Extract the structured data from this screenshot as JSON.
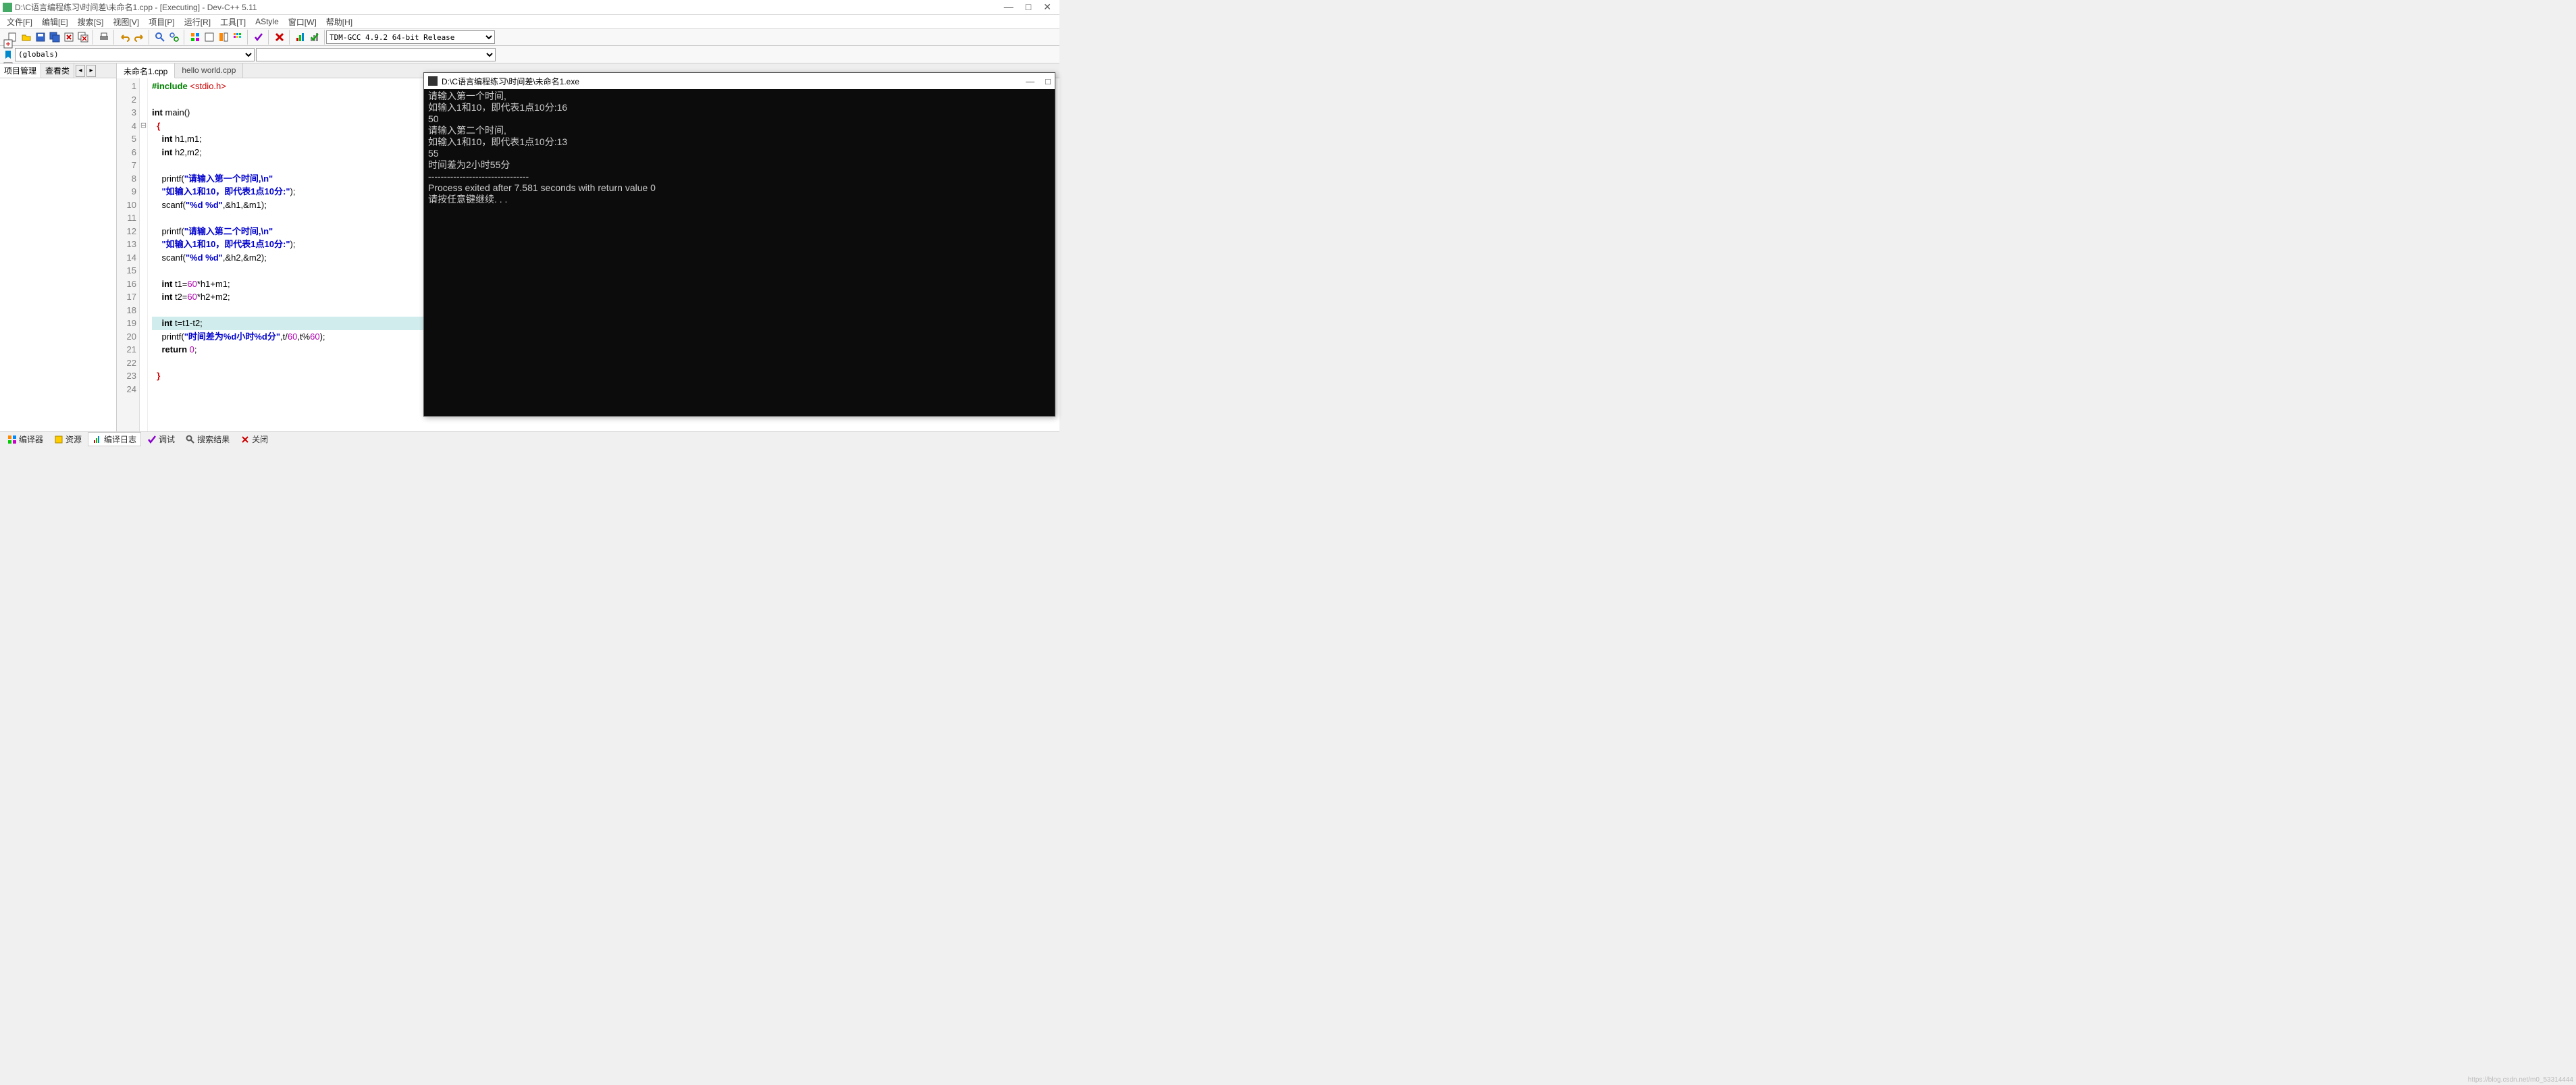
{
  "window": {
    "title": "D:\\C语言编程练习\\时间差\\未命名1.cpp - [Executing] - Dev-C++ 5.11",
    "min": "—",
    "max": "□",
    "close": "✕"
  },
  "menubar": [
    "文件[F]",
    "编辑[E]",
    "搜索[S]",
    "视图[V]",
    "项目[P]",
    "运行[R]",
    "工具[T]",
    "AStyle",
    "窗口[W]",
    "帮助[H]"
  ],
  "toolbar": {
    "compiler_profile": "TDM-GCC 4.9.2 64-bit Release"
  },
  "toolbar2": {
    "scope": "(globals)",
    "members": ""
  },
  "sidebar": {
    "tabs": [
      "项目管理",
      "查看类"
    ]
  },
  "editor_tabs": [
    {
      "label": "未命名1.cpp",
      "active": true
    },
    {
      "label": "hello world.cpp",
      "active": false
    }
  ],
  "code_lines": [
    {
      "n": 1,
      "html": "<span class='pp'>#include</span> <span class='hd'>&lt;stdio.h&gt;</span>"
    },
    {
      "n": 2,
      "html": ""
    },
    {
      "n": 3,
      "html": "<span class='kw'>int</span> <span class='fn'>main</span><span class='pn'>()</span>"
    },
    {
      "n": 4,
      "fold": "⊟",
      "html": "  <span class='br'>{</span>"
    },
    {
      "n": 5,
      "html": "    <span class='kw'>int</span> h1,m1;"
    },
    {
      "n": 6,
      "html": "    <span class='kw'>int</span> h2,m2;"
    },
    {
      "n": 7,
      "html": "    "
    },
    {
      "n": 8,
      "html": "    printf(<span class='str'>\"请输入第一个时间,\\n\"</span>"
    },
    {
      "n": 9,
      "html": "    <span class='str'>\"如输入1和10，即代表1点10分:\"</span>);"
    },
    {
      "n": 10,
      "html": "    scanf(<span class='str'>\"%d %d\"</span>,&amp;h1,&amp;m1);"
    },
    {
      "n": 11,
      "html": "    "
    },
    {
      "n": 12,
      "html": "    printf(<span class='str'>\"请输入第二个时间,\\n\"</span>"
    },
    {
      "n": 13,
      "html": "    <span class='str'>\"如输入1和10，即代表1点10分:\"</span>);"
    },
    {
      "n": 14,
      "html": "    scanf(<span class='str'>\"%d %d\"</span>,&amp;h2,&amp;m2);"
    },
    {
      "n": 15,
      "html": "    "
    },
    {
      "n": 16,
      "html": "    <span class='kw'>int</span> t1=<span class='num'>60</span>*h1+m1;"
    },
    {
      "n": 17,
      "html": "    <span class='kw'>int</span> t2=<span class='num'>60</span>*h2+m2;"
    },
    {
      "n": 18,
      "html": "    "
    },
    {
      "n": 19,
      "hl": true,
      "html": "    <span class='kw'>int</span> t=t1-t2;"
    },
    {
      "n": 20,
      "html": "    printf(<span class='str'>\"时间差为%d小时%d分\"</span>,t/<span class='num'>60</span>,t%<span class='num'>60</span>);"
    },
    {
      "n": 21,
      "html": "    <span class='kw'>return</span> <span class='num'>0</span>;"
    },
    {
      "n": 22,
      "html": "    "
    },
    {
      "n": 23,
      "html": "  <span class='br'>}</span>"
    },
    {
      "n": 24,
      "html": ""
    }
  ],
  "console": {
    "title": "D:\\C语言编程练习\\时间差\\未命名1.exe",
    "lines": [
      "请输入第一个时间,",
      "如输入1和10，即代表1点10分:16",
      "50",
      "请输入第二个时间,",
      "如输入1和10，即代表1点10分:13",
      "55",
      "时间差为2小时55分",
      "--------------------------------",
      "Process exited after 7.581 seconds with return value 0",
      "请按任意键继续. . ."
    ]
  },
  "bottom_tabs": [
    {
      "label": "编译器",
      "icon": "grid"
    },
    {
      "label": "资源",
      "icon": "res"
    },
    {
      "label": "编译日志",
      "icon": "log",
      "active": true
    },
    {
      "label": "调试",
      "icon": "check"
    },
    {
      "label": "搜索结果",
      "icon": "search"
    },
    {
      "label": "关闭",
      "icon": "close"
    }
  ],
  "watermark": "https://blog.csdn.net/m0_53314444"
}
